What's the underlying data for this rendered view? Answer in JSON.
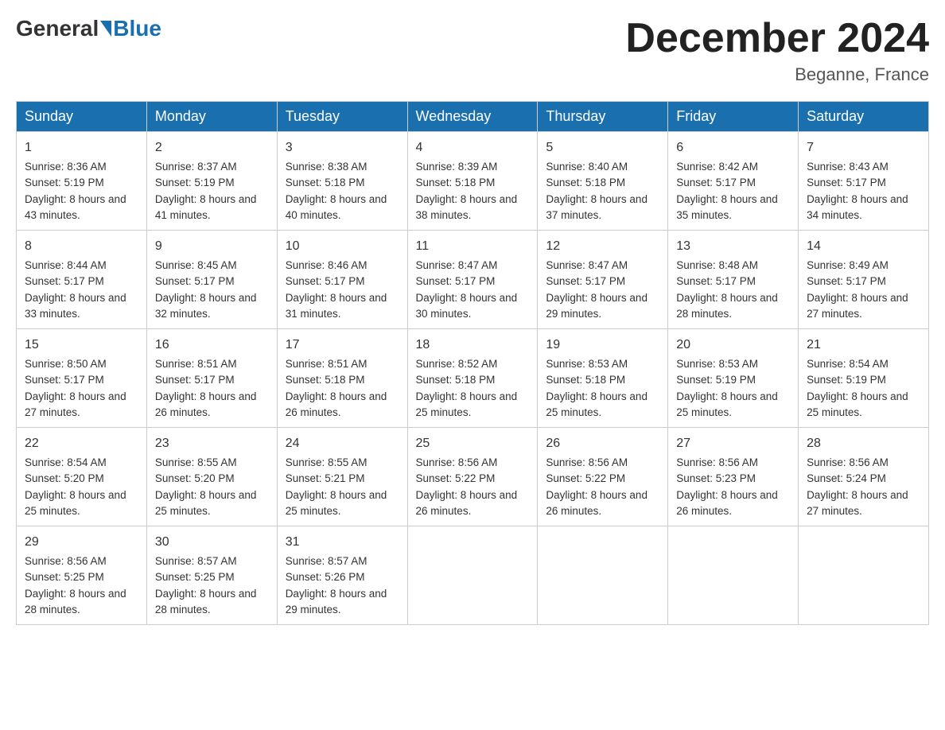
{
  "header": {
    "title": "December 2024",
    "location": "Beganne, France",
    "logo_general": "General",
    "logo_blue": "Blue"
  },
  "days_of_week": [
    "Sunday",
    "Monday",
    "Tuesday",
    "Wednesday",
    "Thursday",
    "Friday",
    "Saturday"
  ],
  "weeks": [
    [
      {
        "day": "1",
        "sunrise": "8:36 AM",
        "sunset": "5:19 PM",
        "daylight": "8 hours and 43 minutes."
      },
      {
        "day": "2",
        "sunrise": "8:37 AM",
        "sunset": "5:19 PM",
        "daylight": "8 hours and 41 minutes."
      },
      {
        "day": "3",
        "sunrise": "8:38 AM",
        "sunset": "5:18 PM",
        "daylight": "8 hours and 40 minutes."
      },
      {
        "day": "4",
        "sunrise": "8:39 AM",
        "sunset": "5:18 PM",
        "daylight": "8 hours and 38 minutes."
      },
      {
        "day": "5",
        "sunrise": "8:40 AM",
        "sunset": "5:18 PM",
        "daylight": "8 hours and 37 minutes."
      },
      {
        "day": "6",
        "sunrise": "8:42 AM",
        "sunset": "5:17 PM",
        "daylight": "8 hours and 35 minutes."
      },
      {
        "day": "7",
        "sunrise": "8:43 AM",
        "sunset": "5:17 PM",
        "daylight": "8 hours and 34 minutes."
      }
    ],
    [
      {
        "day": "8",
        "sunrise": "8:44 AM",
        "sunset": "5:17 PM",
        "daylight": "8 hours and 33 minutes."
      },
      {
        "day": "9",
        "sunrise": "8:45 AM",
        "sunset": "5:17 PM",
        "daylight": "8 hours and 32 minutes."
      },
      {
        "day": "10",
        "sunrise": "8:46 AM",
        "sunset": "5:17 PM",
        "daylight": "8 hours and 31 minutes."
      },
      {
        "day": "11",
        "sunrise": "8:47 AM",
        "sunset": "5:17 PM",
        "daylight": "8 hours and 30 minutes."
      },
      {
        "day": "12",
        "sunrise": "8:47 AM",
        "sunset": "5:17 PM",
        "daylight": "8 hours and 29 minutes."
      },
      {
        "day": "13",
        "sunrise": "8:48 AM",
        "sunset": "5:17 PM",
        "daylight": "8 hours and 28 minutes."
      },
      {
        "day": "14",
        "sunrise": "8:49 AM",
        "sunset": "5:17 PM",
        "daylight": "8 hours and 27 minutes."
      }
    ],
    [
      {
        "day": "15",
        "sunrise": "8:50 AM",
        "sunset": "5:17 PM",
        "daylight": "8 hours and 27 minutes."
      },
      {
        "day": "16",
        "sunrise": "8:51 AM",
        "sunset": "5:17 PM",
        "daylight": "8 hours and 26 minutes."
      },
      {
        "day": "17",
        "sunrise": "8:51 AM",
        "sunset": "5:18 PM",
        "daylight": "8 hours and 26 minutes."
      },
      {
        "day": "18",
        "sunrise": "8:52 AM",
        "sunset": "5:18 PM",
        "daylight": "8 hours and 25 minutes."
      },
      {
        "day": "19",
        "sunrise": "8:53 AM",
        "sunset": "5:18 PM",
        "daylight": "8 hours and 25 minutes."
      },
      {
        "day": "20",
        "sunrise": "8:53 AM",
        "sunset": "5:19 PM",
        "daylight": "8 hours and 25 minutes."
      },
      {
        "day": "21",
        "sunrise": "8:54 AM",
        "sunset": "5:19 PM",
        "daylight": "8 hours and 25 minutes."
      }
    ],
    [
      {
        "day": "22",
        "sunrise": "8:54 AM",
        "sunset": "5:20 PM",
        "daylight": "8 hours and 25 minutes."
      },
      {
        "day": "23",
        "sunrise": "8:55 AM",
        "sunset": "5:20 PM",
        "daylight": "8 hours and 25 minutes."
      },
      {
        "day": "24",
        "sunrise": "8:55 AM",
        "sunset": "5:21 PM",
        "daylight": "8 hours and 25 minutes."
      },
      {
        "day": "25",
        "sunrise": "8:56 AM",
        "sunset": "5:22 PM",
        "daylight": "8 hours and 26 minutes."
      },
      {
        "day": "26",
        "sunrise": "8:56 AM",
        "sunset": "5:22 PM",
        "daylight": "8 hours and 26 minutes."
      },
      {
        "day": "27",
        "sunrise": "8:56 AM",
        "sunset": "5:23 PM",
        "daylight": "8 hours and 26 minutes."
      },
      {
        "day": "28",
        "sunrise": "8:56 AM",
        "sunset": "5:24 PM",
        "daylight": "8 hours and 27 minutes."
      }
    ],
    [
      {
        "day": "29",
        "sunrise": "8:56 AM",
        "sunset": "5:25 PM",
        "daylight": "8 hours and 28 minutes."
      },
      {
        "day": "30",
        "sunrise": "8:57 AM",
        "sunset": "5:25 PM",
        "daylight": "8 hours and 28 minutes."
      },
      {
        "day": "31",
        "sunrise": "8:57 AM",
        "sunset": "5:26 PM",
        "daylight": "8 hours and 29 minutes."
      },
      null,
      null,
      null,
      null
    ]
  ]
}
